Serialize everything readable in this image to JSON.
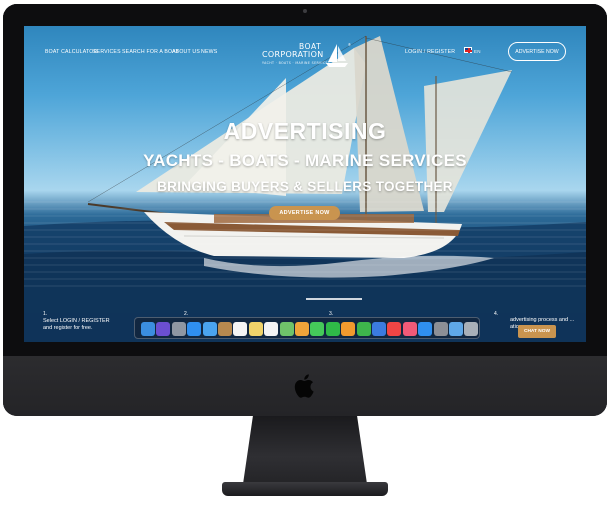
{
  "nav": {
    "items": [
      "BOAT CALCULATOR",
      "SERVICES",
      "SEARCH FOR A BOAT",
      "ABOUT US",
      "NEWS"
    ],
    "login": "LOGIN / REGISTER",
    "language": "EN",
    "advertise_button": "ADVERTISE NOW"
  },
  "logo": {
    "word1": "BOAT",
    "word2": "CORPORATION",
    "tagline": "YACHT · BOATS · MARINE SERVICES"
  },
  "hero": {
    "title": "ADVERTISING",
    "subtitle": "YACHTS - BOATS - MARINE SERVICES",
    "tagline": "BRINGING BUYERS & SELLERS TOGETHER",
    "cta": "ADVERTISE NOW"
  },
  "steps": {
    "step1_number": "1.",
    "step1_text": "Select LOGIN / REGISTER and register for free.",
    "step2_number": "2.",
    "step3_number": "3.",
    "step4_number": "4.",
    "step4_text": "advertising process and ...",
    "step4_line2": "ation",
    "chat_button": "CHAT NOW"
  },
  "dock_icons": [
    {
      "name": "finder-icon",
      "color": "#3b8ee0"
    },
    {
      "name": "siri-icon",
      "color": "#6b4fd1"
    },
    {
      "name": "launchpad-icon",
      "color": "#8f97a3"
    },
    {
      "name": "safari-icon",
      "color": "#2f8ff0"
    },
    {
      "name": "mail-icon",
      "color": "#4aa4f0"
    },
    {
      "name": "contacts-icon",
      "color": "#b7894f"
    },
    {
      "name": "calendar-icon",
      "color": "#f4f4f4"
    },
    {
      "name": "notes-icon",
      "color": "#f1d36a"
    },
    {
      "name": "reminders-icon",
      "color": "#f4f4f4"
    },
    {
      "name": "maps-icon",
      "color": "#6fc26a"
    },
    {
      "name": "photos-icon",
      "color": "#f0a43a"
    },
    {
      "name": "messages-icon",
      "color": "#45c95a"
    },
    {
      "name": "facetime-icon",
      "color": "#2fba48"
    },
    {
      "name": "pages-icon",
      "color": "#f29a2e"
    },
    {
      "name": "numbers-icon",
      "color": "#3eb54c"
    },
    {
      "name": "keynote-icon",
      "color": "#3b7be0"
    },
    {
      "name": "news-icon",
      "color": "#f04545"
    },
    {
      "name": "music-icon",
      "color": "#f05a78"
    },
    {
      "name": "appstore-icon",
      "color": "#2f8ff0"
    },
    {
      "name": "settings-icon",
      "color": "#8c8f96"
    },
    {
      "name": "folder-icon",
      "color": "#5fa8e8"
    },
    {
      "name": "trash-icon",
      "color": "#a9b0b8"
    }
  ],
  "colors": {
    "accent": "#c9944f",
    "nav_text": "#ffffff",
    "imac_body": "#242427"
  }
}
